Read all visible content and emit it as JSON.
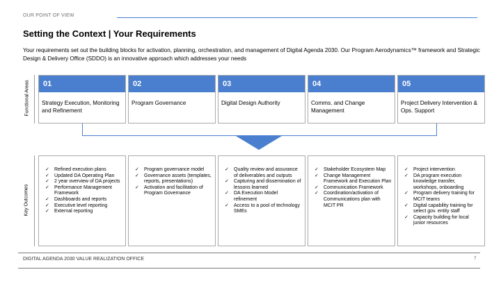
{
  "header": {
    "section_label": "OUR POINT OF VIEW",
    "title": "Setting the Context | Your Requirements",
    "intro": "Your requirements set out the building blocks for activation, planning, orchestration, and management of Digital Agenda 2030. Our Program Aerodynamics™ framework and Strategic Design & Delivery Office (SDDO) is an innovative approach which addresses your needs"
  },
  "labels": {
    "functional_areas": "Functional Areas",
    "key_outcomes": "Key Outcomes"
  },
  "areas": [
    {
      "number": "01",
      "title": "Strategy Execution, Monitoring and Refinement"
    },
    {
      "number": "02",
      "title": "Program Governance"
    },
    {
      "number": "03",
      "title": "Digital Design Authority"
    },
    {
      "number": "04",
      "title": "Comms. and Change Management"
    },
    {
      "number": "05",
      "title": "Project Delivery Intervention & Ops. Support"
    }
  ],
  "outcomes": [
    [
      "Refined execution plans",
      "Updated DA Operating Plan",
      "2 year overview of DA projects",
      "Performance Management Framework",
      "Dashboards and reports",
      "Executive level reporting",
      "External reporting"
    ],
    [
      "Program governance model",
      "Governance assets (templates, reports, presentations)",
      "Activation and facilitation of Program Governance"
    ],
    [
      "Quality review and assurance of deliverables and outputs",
      "Capturing and dissemination of lessons learned",
      "DA Execution Model refinement",
      "Access to a pool of technology SMEs"
    ],
    [
      "Stakeholder Ecosystem Map",
      "Change Management Framework and Execution Plan",
      "Communication Framework",
      "Coordination/activation of Communications plan with MCIT PR"
    ],
    [
      "Project intervention",
      "DA program execution knowledge transfer, workshops, onboarding",
      "Program delivery training for MCIT teams",
      "Digital capability training for select gov. entity staff",
      "Capacity building for local junior resources"
    ]
  ],
  "check_glyph": "✓",
  "footer": {
    "text": "DIGITAL AGENDA 2030 VALUE REALIZATION OFFICE",
    "page_number": "7"
  },
  "colors": {
    "accent": "#4a7fd0",
    "border": "#a9a9a9"
  }
}
